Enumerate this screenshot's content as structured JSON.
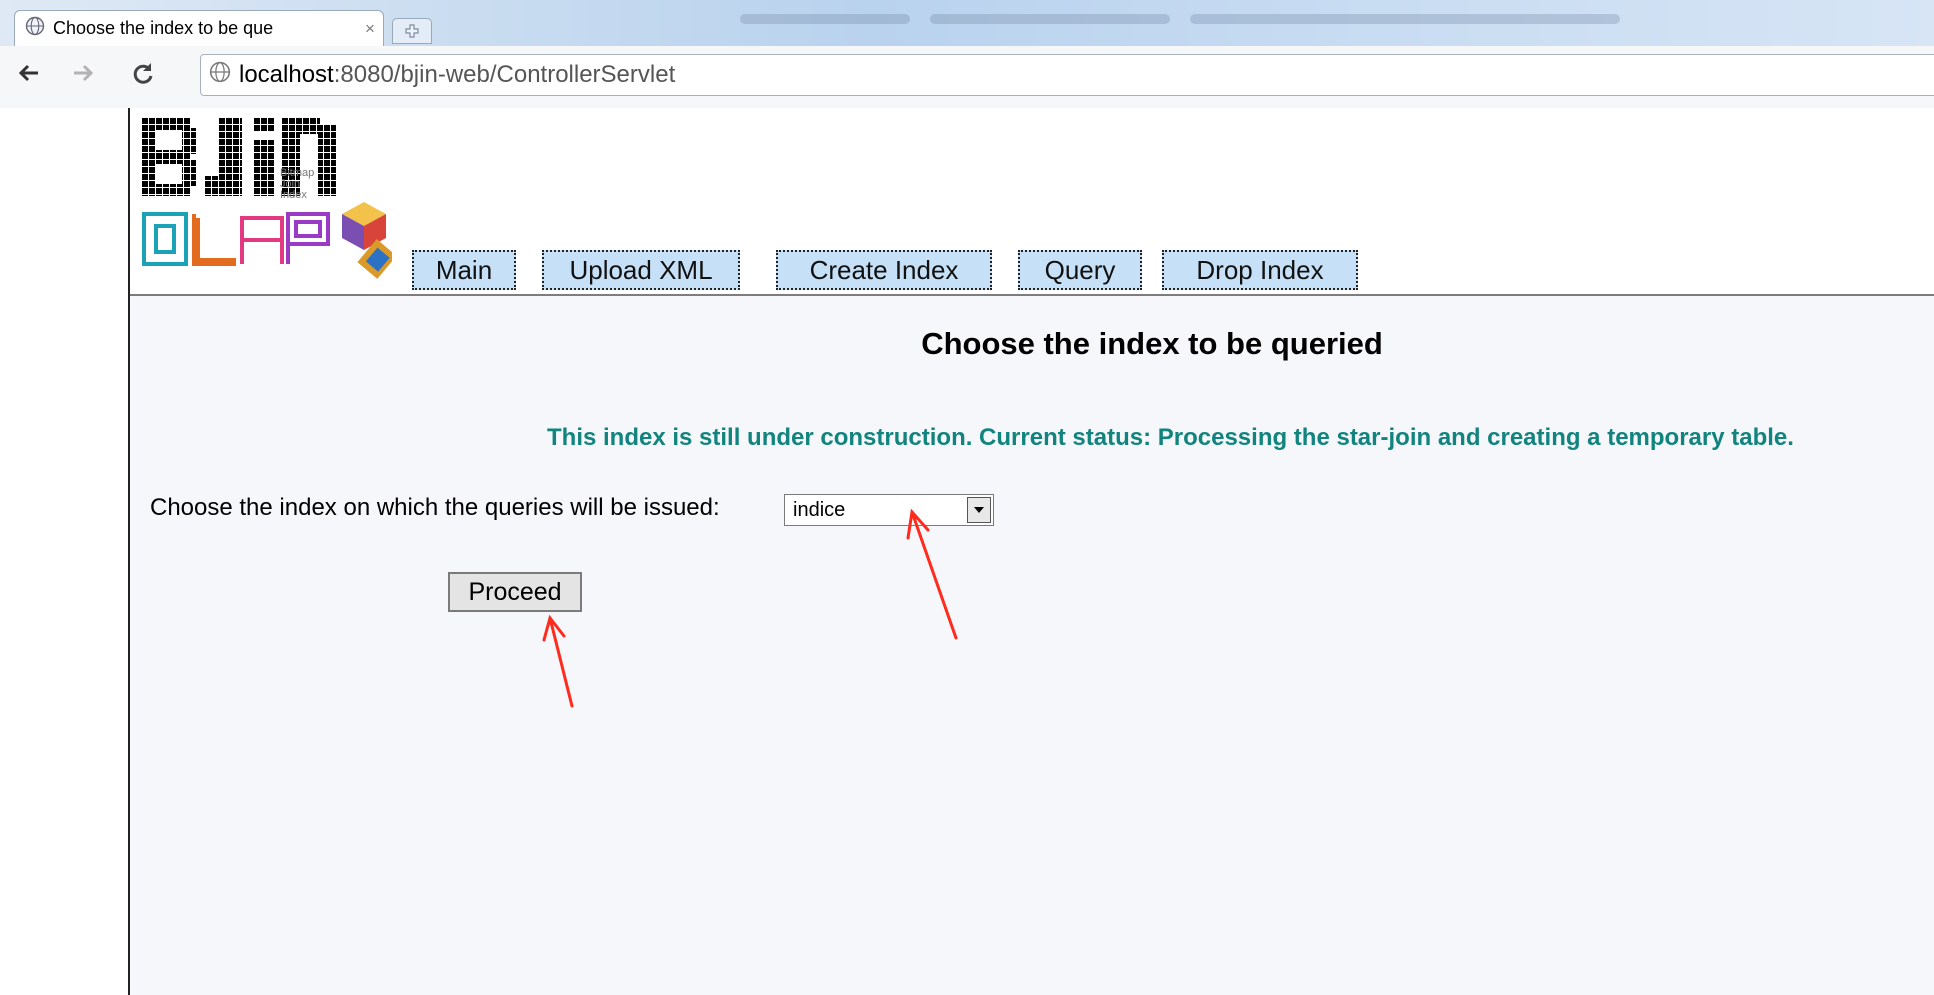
{
  "browser": {
    "tab_title": "Choose the index to be que",
    "tab_close": "×",
    "url_host": "localhost",
    "url_path": ":8080/bjin-web/ControllerServlet"
  },
  "logo": {
    "wordmark": "BJiN",
    "subtext": [
      "Bitmap",
      "Join",
      "Index"
    ],
    "olap": "OLAP"
  },
  "menu": {
    "items": [
      {
        "label": "Main"
      },
      {
        "label": "Upload XML"
      },
      {
        "label": "Create Index"
      },
      {
        "label": "Query"
      },
      {
        "label": "Drop Index"
      }
    ]
  },
  "page": {
    "heading": "Choose the index to be queried",
    "status_message": "This index is still under construction. Current status: Processing the star-join and creating a temporary table.",
    "prompt": "Choose the index on which the queries will be issued:",
    "select_value": "indice",
    "proceed_label": "Proceed"
  },
  "colors": {
    "menu_bg": "#c6e0f7",
    "status_text": "#12847e",
    "content_bg": "#f5f7fb",
    "annotation_arrow": "#ff2b1c"
  },
  "icons": [
    "globe-icon",
    "back-arrow-icon",
    "forward-arrow-icon",
    "reload-icon",
    "new-tab-icon",
    "dropdown-arrow-icon"
  ]
}
